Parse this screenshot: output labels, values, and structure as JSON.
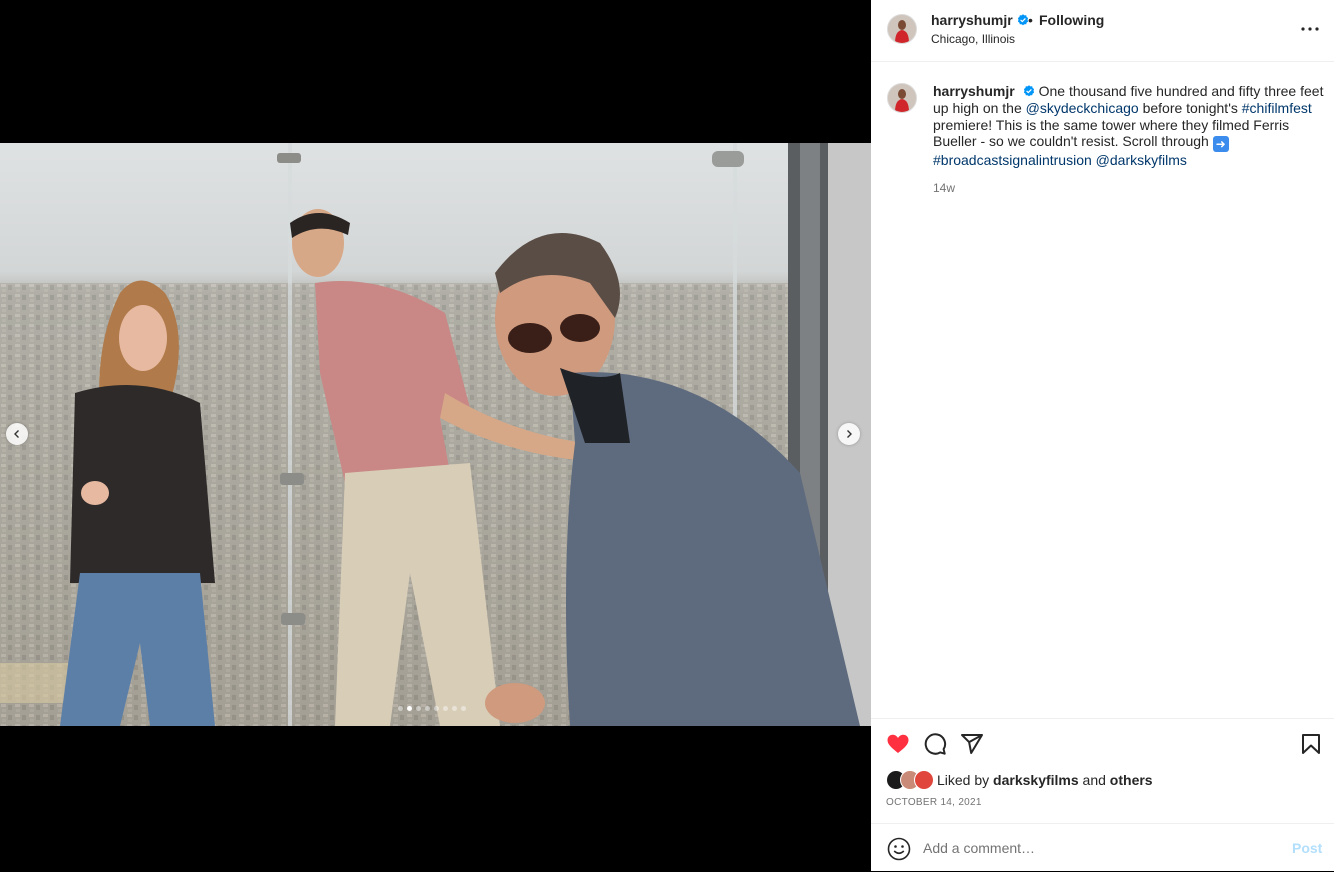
{
  "post": {
    "username": "harryshumjr",
    "verified": true,
    "follow_separator": "•",
    "follow_status": "Following",
    "location": "Chicago, Illinois",
    "more_icon": "more-horizontal-icon"
  },
  "media": {
    "carousel_total": 8,
    "carousel_current": 2,
    "prev_icon": "chevron-left-icon",
    "next_icon": "chevron-right-icon"
  },
  "caption": {
    "username": "harryshumjr",
    "text_1": "One thousand five hundred and fifty three feet up high on the",
    "mention_1": "@skydeckchicago",
    "text_2": "before tonight's",
    "hashtag_1": "#chifilmfest",
    "text_3": "premiere! This is the same tower where they filmed Ferris Bueller - so we couldn't resist. Scroll through",
    "emoji": "➡️",
    "hashtag_2": "#broadcastsignalintrusion",
    "mention_2": "@darkskyfilms",
    "time_ago": "14w"
  },
  "actions": {
    "like_icon": "heart-filled-icon",
    "comment_icon": "comment-icon",
    "share_icon": "share-icon",
    "save_icon": "bookmark-icon",
    "liked_state": true,
    "like_color": "#ff3040"
  },
  "likes": {
    "prefix": "Liked by",
    "user": "darkskyfilms",
    "connector": "and",
    "others": "others",
    "date": "OCTOBER 14, 2021"
  },
  "comment": {
    "emoji_icon": "smiley-icon",
    "placeholder": "Add a comment…",
    "post_label": "Post"
  },
  "colors": {
    "link": "#00376b",
    "verified": "#0095f6",
    "post_disabled": "#b2dffc"
  }
}
